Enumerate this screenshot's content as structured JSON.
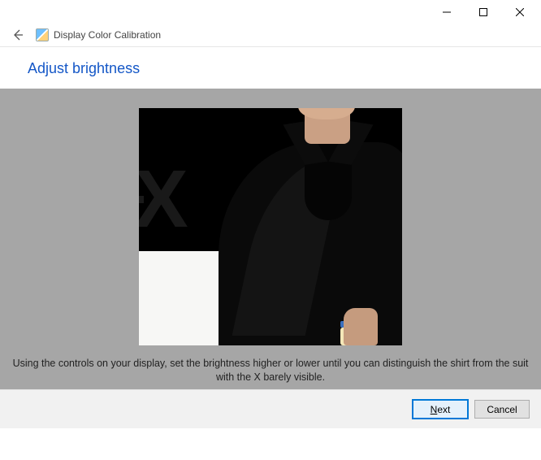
{
  "window": {
    "title": "Display Color Calibration"
  },
  "heading": "Adjust brightness",
  "instruction": "Using the controls on your display, set the brightness higher or lower until you can distinguish the shirt from the suit with the X barely visible.",
  "buttons": {
    "next": "Next",
    "cancel": "Cancel"
  }
}
